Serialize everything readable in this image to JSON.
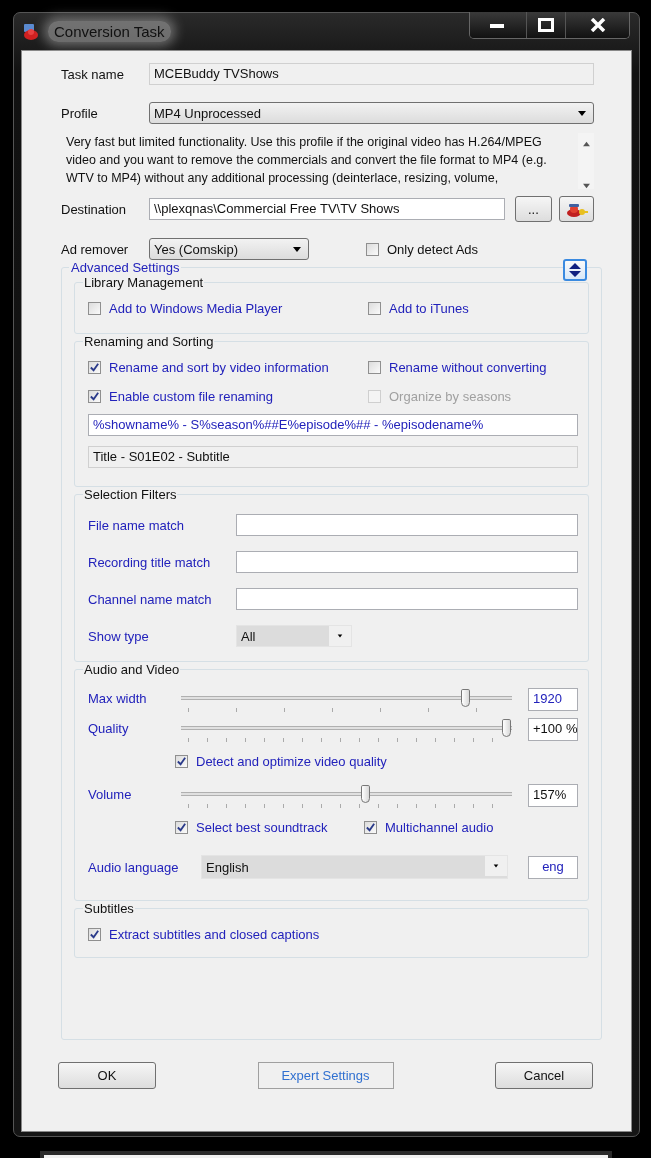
{
  "window": {
    "title": "Conversion Task"
  },
  "task_name": {
    "label": "Task name",
    "value": "MCEBuddy TVShows"
  },
  "profile": {
    "label": "Profile",
    "value": "MP4 Unprocessed"
  },
  "description": "Very fast but limited functionality. Use this profile if the original video has H.264/MPEG video and you want to remove the commercials and convert the file format to MP4 (e.g. WTV to MP4) without any additional processing (deinterlace, resizing, volume,",
  "destination": {
    "label": "Destination",
    "value": "\\\\plexqnas\\Commercial Free TV\\TV Shows",
    "browse": "..."
  },
  "ad_remover": {
    "label": "Ad remover",
    "value": "Yes (Comskip)"
  },
  "only_detect_ads": {
    "label": "Only detect Ads",
    "checked": false
  },
  "advanced_settings": {
    "title": "Advanced Settings",
    "expanded": true,
    "library_management": {
      "title": "Library Management",
      "options": [
        {
          "label": "Add to Windows Media Player",
          "checked": false,
          "disabled": false
        },
        {
          "label": "Add to iTunes",
          "checked": false,
          "disabled": false
        }
      ]
    },
    "renaming": {
      "title": "Renaming and Sorting",
      "options": [
        {
          "label": "Rename and sort by video information",
          "checked": true,
          "disabled": false
        },
        {
          "label": "Rename without converting",
          "checked": false,
          "disabled": false
        },
        {
          "label": "Enable custom file renaming",
          "checked": true,
          "disabled": false
        },
        {
          "label": "Organize by seasons",
          "checked": false,
          "disabled": true
        }
      ],
      "pattern": "%showname% - S%season%##E%episode%## - %episodename%",
      "preview": "Title - S01E02 - Subtitle"
    },
    "selection_filters": {
      "title": "Selection Filters",
      "fields": [
        {
          "label": "File name match",
          "kind": "text"
        },
        {
          "label": "Recording title match",
          "kind": "text"
        },
        {
          "label": "Channel name match",
          "kind": "text"
        },
        {
          "label": "Show type",
          "kind": "dropdown",
          "value": "All"
        }
      ]
    },
    "audio_video": {
      "title": "Audio and Video",
      "rows": [
        {
          "kind": "slider",
          "label": "Max width",
          "level": 0.86,
          "reading": "1920"
        },
        {
          "kind": "slider",
          "label": "Quality",
          "level": 0.985,
          "reading": "+100 %"
        },
        {
          "kind": "checks",
          "options": [
            {
              "label": "Detect and optimize video quality",
              "checked": true
            }
          ]
        },
        {
          "kind": "slider",
          "label": "Volume",
          "level": 0.56,
          "reading": "157%"
        },
        {
          "kind": "checks",
          "options": [
            {
              "label": "Select best soundtrack",
              "checked": true
            },
            {
              "label": "Multichannel audio",
              "checked": true
            }
          ]
        },
        {
          "kind": "dropdown",
          "label": "Audio language",
          "value": "English",
          "reading": "eng"
        }
      ]
    },
    "subtitles": {
      "title": "Subtitles",
      "options": [
        {
          "label": "Extract subtitles and closed captions",
          "checked": true,
          "disabled": false
        }
      ]
    }
  },
  "buttons": [
    {
      "label": "OK",
      "kind": "standard"
    },
    {
      "label": "Expert Settings",
      "kind": "flat"
    },
    {
      "label": "Cancel",
      "kind": "standard"
    }
  ]
}
